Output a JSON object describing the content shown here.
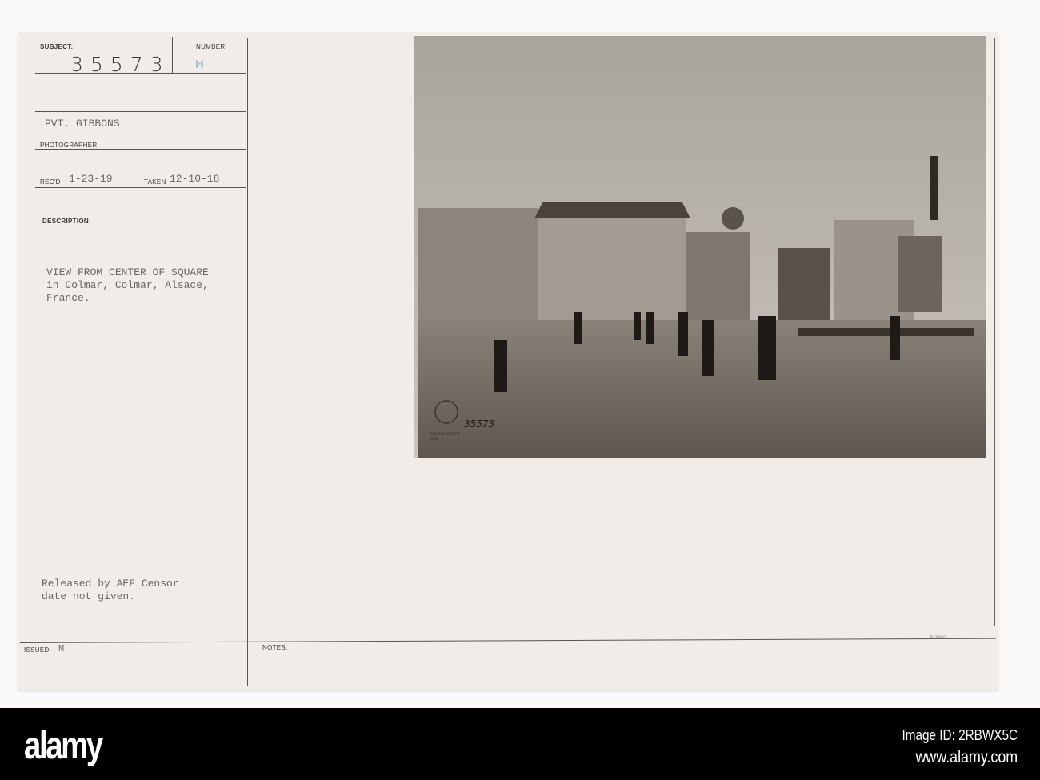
{
  "card": {
    "subject_label": "SUBJECT:",
    "number_label": "NUMBER",
    "subject_number": "35573",
    "number_stamp": "H",
    "photographer": "PVT. GIBBONS",
    "photographer_label": "PHOTOGRAPHER",
    "recd_label": "REC'D",
    "recd_date": "1-23-19",
    "taken_label": "TAKEN",
    "taken_date": "12-10-18",
    "description_label": "DESCRIPTION:",
    "description": "VIEW FROM CENTER OF SQUARE\nin Colmar, Colmar, Alsace,\nFrance.",
    "release_note": "Released by AEF Censor\ndate not given.",
    "issued_label": "ISSUED:",
    "issued_value": "M",
    "notes_label": "NOTES:",
    "form_code": "5-3003"
  },
  "photo": {
    "stamp_text": "SIGNAL CORPS USA",
    "photo_number": "35573"
  },
  "footer": {
    "logo": "alamy",
    "image_id": "Image ID: 2RBWX5C",
    "url": "www.alamy.com"
  }
}
